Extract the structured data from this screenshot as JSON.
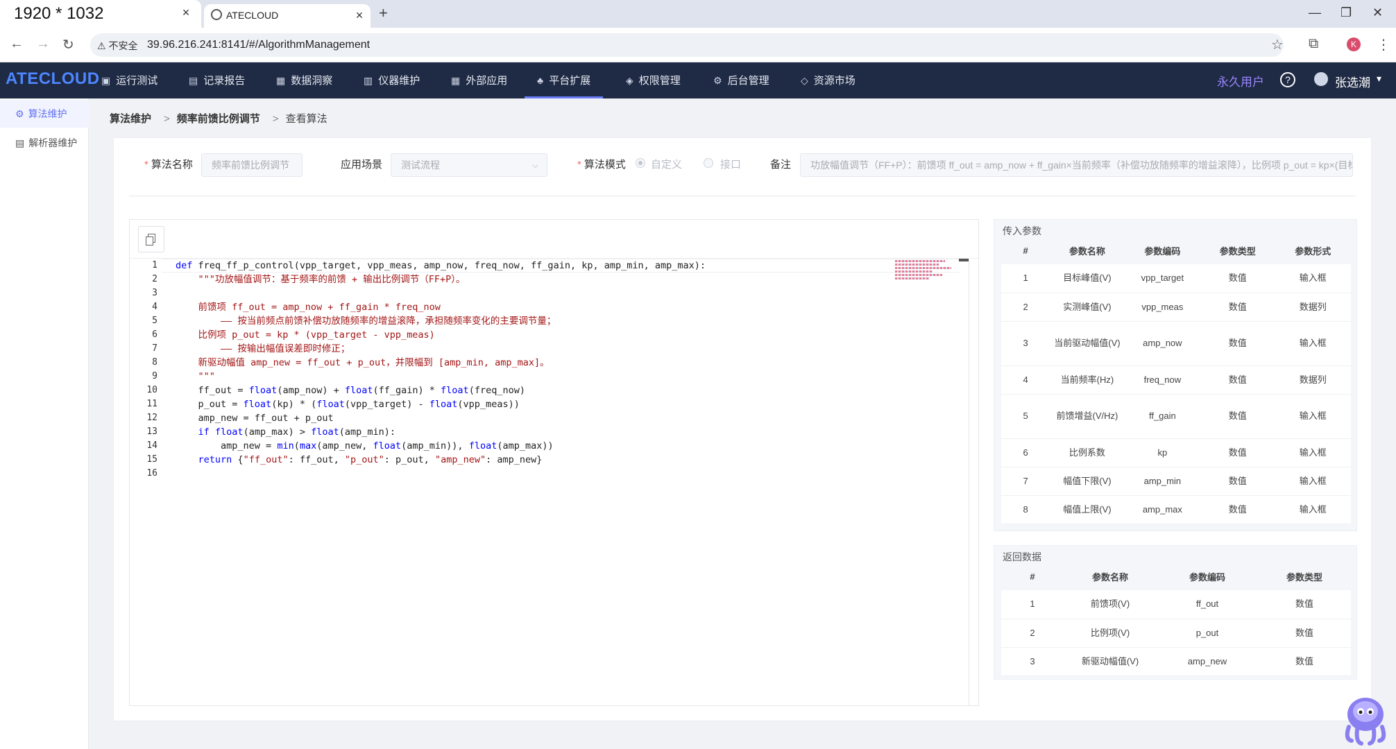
{
  "browser": {
    "tab1_title": "1920 * 1032",
    "tab2_title": "ATECLOUD",
    "tab_close": "×",
    "new_tab": "+",
    "url_warning": "⚠ 不安全",
    "url": "39.96.216.241:8141/#/AlgorithmManagement",
    "profile_initial": "K"
  },
  "header": {
    "logo": "ATECLOUD",
    "menu": [
      {
        "label": "运行测试",
        "icon": "▣"
      },
      {
        "label": "记录报告",
        "icon": "▤"
      },
      {
        "label": "数据洞察",
        "icon": "▦"
      },
      {
        "label": "仪器维护",
        "icon": "▥"
      },
      {
        "label": "外部应用",
        "icon": "▦"
      },
      {
        "label": "平台扩展",
        "icon": "♣"
      },
      {
        "label": "权限管理",
        "icon": "◈"
      },
      {
        "label": "后台管理",
        "icon": "⚙"
      },
      {
        "label": "资源市场",
        "icon": "◇"
      }
    ],
    "user_type": "永久用户",
    "help": "?",
    "user_name": "张选潮",
    "caret": "▾"
  },
  "sidebar": {
    "items": [
      {
        "label": "算法维护",
        "icon": "⚙"
      },
      {
        "label": "解析器维护",
        "icon": "▤"
      }
    ]
  },
  "breadcrumb": {
    "items": [
      "算法维护",
      "频率前馈比例调节",
      "查看算法"
    ],
    "sep": ">"
  },
  "form": {
    "name_label": "算法名称",
    "name_value": "频率前馈比例调节",
    "scene_label": "应用场景",
    "scene_value": "测试流程",
    "mode_label": "算法模式",
    "mode_custom": "自定义",
    "mode_api": "接口",
    "remark_label": "备注",
    "remark_value": "功放幅值调节（FF+P）：前馈项 ff_out = amp_now + ff_gain×当前频率（补偿功放随频率的增益滚降），比例项 p_out = kp×(目标"
  },
  "code": {
    "line_numbers": [
      "1",
      "2",
      "3",
      "4",
      "5",
      "6",
      "7",
      "8",
      "9",
      "10",
      "11",
      "12",
      "13",
      "14",
      "15",
      "16"
    ]
  },
  "input_params": {
    "title": "传入参数",
    "headers": [
      "#",
      "参数名称",
      "参数编码",
      "参数类型",
      "参数形式"
    ],
    "rows": [
      [
        "1",
        "目标峰值(V)",
        "vpp_target",
        "数值",
        "输入框"
      ],
      [
        "2",
        "实测峰值(V)",
        "vpp_meas",
        "数值",
        "数据列"
      ],
      [
        "3",
        "当前驱动幅值(V)",
        "amp_now",
        "数值",
        "输入框"
      ],
      [
        "4",
        "当前频率(Hz)",
        "freq_now",
        "数值",
        "数据列"
      ],
      [
        "5",
        "前馈增益(V/Hz)",
        "ff_gain",
        "数值",
        "输入框"
      ],
      [
        "6",
        "比例系数",
        "kp",
        "数值",
        "输入框"
      ],
      [
        "7",
        "幅值下限(V)",
        "amp_min",
        "数值",
        "输入框"
      ],
      [
        "8",
        "幅值上限(V)",
        "amp_max",
        "数值",
        "输入框"
      ]
    ]
  },
  "return_data": {
    "title": "返回数据",
    "headers": [
      "#",
      "参数名称",
      "参数编码",
      "参数类型"
    ],
    "rows": [
      [
        "1",
        "前馈项(V)",
        "ff_out",
        "数值"
      ],
      [
        "2",
        "比例项(V)",
        "p_out",
        "数值"
      ],
      [
        "3",
        "新驱动幅值(V)",
        "amp_new",
        "数值"
      ]
    ]
  }
}
